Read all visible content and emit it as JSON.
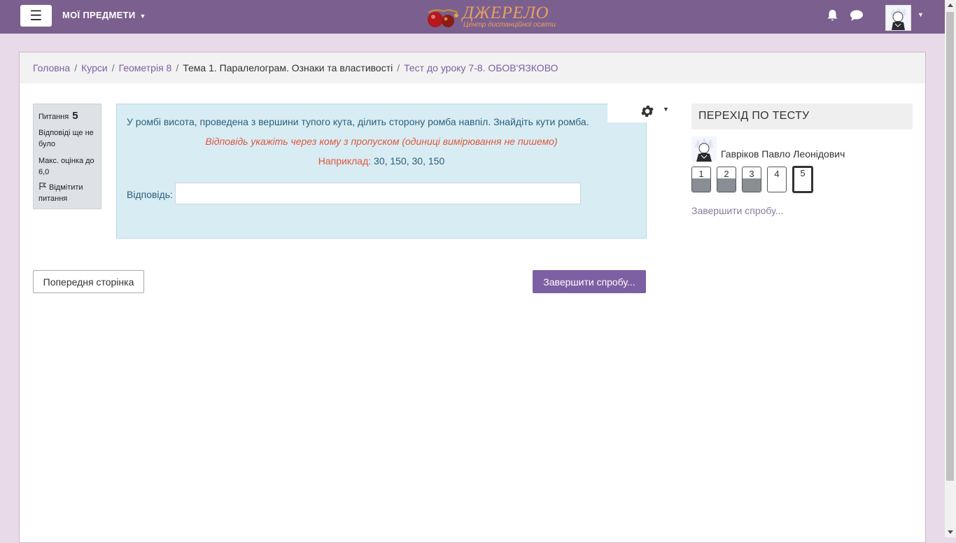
{
  "navbar": {
    "my_courses": "МОЇ ПРЕДМЕТИ",
    "brand_name": "ДЖЕРЕЛО",
    "brand_tagline": "Центр дистанційної освіти",
    "bg_color": "#7b5f8f"
  },
  "breadcrumb": {
    "items": [
      "Головна",
      "Курси",
      "Геометрія 8",
      "Тема 1. Паралелограм. Ознаки та властивості",
      "Тест до уроку 7-8. ОБОВ'ЯЗКОВО"
    ]
  },
  "question_info": {
    "label": "Питання",
    "number": "5",
    "state": "Відповіді ще не було",
    "grade": "Макс. оцінка до 6,0",
    "flag": "Відмітити питання"
  },
  "question": {
    "text": "У ромбі висота, проведена з вершини тупого кута, ділить сторону ромба навпіл. Знайдіть кути ромба.",
    "hint": "Відповідь укажіть через кому з пропуском (одиниці вимірювання не пишемо)",
    "example_label": "Наприклад:",
    "example_value": " 30, 150, 30, 150",
    "answer_label": "Відповідь:",
    "answer_value": ""
  },
  "buttons": {
    "prev_page": "Попередня сторінка",
    "finish_attempt": "Завершити спробу..."
  },
  "quiz_nav": {
    "title": "ПЕРЕХІД ПО ТЕСТУ",
    "user_name": "Гавріков Павло Леонідович",
    "questions": [
      {
        "label": "1",
        "state": "answered"
      },
      {
        "label": "2",
        "state": "answered"
      },
      {
        "label": "3",
        "state": "answered"
      },
      {
        "label": "4",
        "state": "notyetanswered"
      },
      {
        "label": "5",
        "state": "current"
      }
    ],
    "finish_link": "Завершити спробу..."
  },
  "colors": {
    "accent": "#7d5fa3",
    "question_bg": "#d8ecf4",
    "hint": "#e0583a"
  }
}
